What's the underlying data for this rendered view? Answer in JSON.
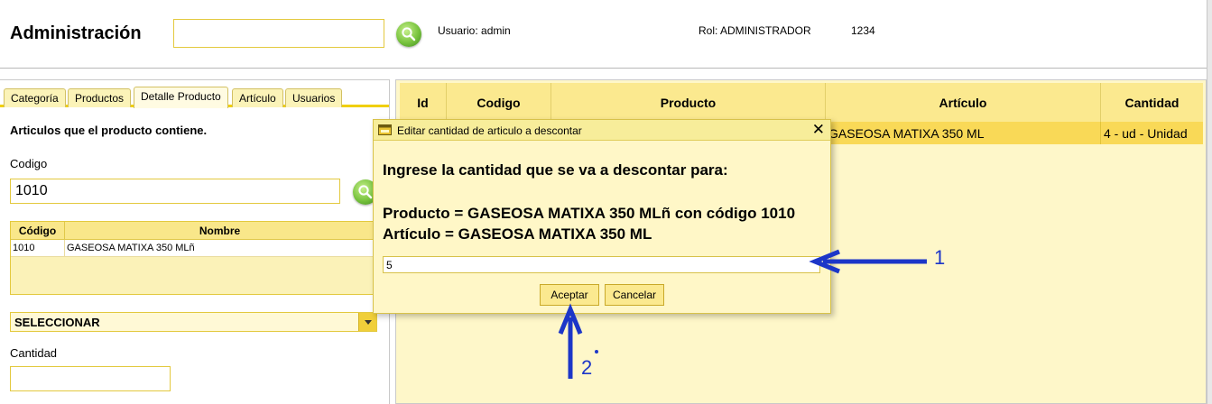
{
  "header": {
    "title": "Administración",
    "search_value": "",
    "user_text": "Usuario: admin",
    "role_text": "Rol: ADMINISTRADOR",
    "code_text": "1234"
  },
  "left_panel": {
    "tabs": [
      {
        "label": "Categoría"
      },
      {
        "label": "Productos"
      },
      {
        "label": "Detalle Producto"
      },
      {
        "label": "Artículo"
      },
      {
        "label": "Usuarios"
      }
    ],
    "section_title": "Articulos que el producto contiene.",
    "codigo_label": "Codigo",
    "codigo_value": "1010",
    "mini_table": {
      "headers": [
        "Código",
        "Nombre"
      ],
      "rows": [
        [
          "1010",
          "GASEOSA MATIXA 350 MLñ"
        ]
      ]
    },
    "select_value": "SELECCIONAR",
    "cantidad_label": "Cantidad",
    "cantidad_value": ""
  },
  "grid": {
    "headers": [
      "Id",
      "Codigo",
      "Producto",
      "Artículo",
      "Cantidad"
    ],
    "rows": [
      [
        "",
        "",
        "",
        "GASEOSA MATIXA 350 ML",
        "4 - ud - Unidad"
      ]
    ]
  },
  "dialog": {
    "title": "Editar cantidad de articulo a descontar",
    "close": "✕",
    "prompt": "Ingrese la cantidad que se va a descontar para:",
    "producto_line": "Producto = GASEOSA MATIXA 350 MLñ con código 1010",
    "articulo_line": "Artículo = GASEOSA MATIXA 350 ML",
    "input_value": "5",
    "accept_label": "Aceptar",
    "cancel_label": "Cancelar"
  },
  "annotations": {
    "label_1": "1",
    "label_2": "2",
    "arrow_color": "#1c36c8"
  },
  "colors": {
    "accent_yellow": "#f0cf00",
    "grid_background": "#fef7c9",
    "selected_row": "#f9d957",
    "search_button_green": "#78c33e"
  },
  "icons": {
    "header_search": "search-icon",
    "codigo_search": "search-icon",
    "dialog_title": "window-icon",
    "select_dropdown": "chevron-down-icon"
  }
}
